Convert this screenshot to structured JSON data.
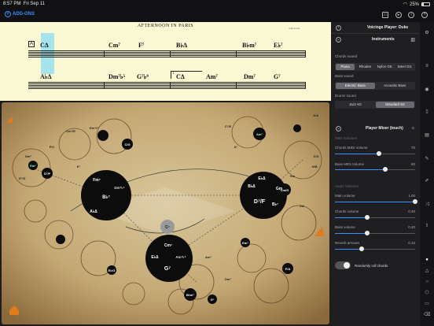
{
  "status": {
    "time": "8:57 PM",
    "date": "Fri Sep 11",
    "battery": "25%"
  },
  "toolbar": {
    "addons_label": "ADD-ONS"
  },
  "sheet": {
    "title": "AFTERNOON IN PARIS",
    "composer": "John Lewis",
    "section_a": "A",
    "ending_1": "1",
    "row1_chords": [
      "CΔ",
      "Cm⁷",
      "F⁷",
      "B♭Δ",
      "B♭m⁷",
      "E♭⁷"
    ],
    "row2_chords": [
      "A♭Δ",
      "Dm⁷♭⁵",
      "G⁷♭⁹",
      "CΔ",
      "Am⁷",
      "Dm⁷",
      "G⁷"
    ]
  },
  "panel": {
    "voicings_title": "Voicings Player: Duke",
    "instruments_title": "Instruments",
    "chords_sound_label": "Chords sound",
    "chords_sound_options": [
      "Piano",
      "Rhodes",
      "Nylon Gtr.",
      "Steel Gtr."
    ],
    "chords_sound_selected": "Piano",
    "bass_sound_label": "Bass sound",
    "bass_sound_options": [
      "Electric Bass",
      "Acoustic Bass"
    ],
    "bass_sound_selected": "Electric Bass",
    "drums_sound_label": "Drums sound",
    "drums_sound_options": [
      "Jazz Kit",
      "Standard Kit"
    ],
    "drums_sound_selected": "Standard Kit",
    "mixer_title": "Player Mixer (touch)",
    "midi_volumes_label": "MIDI Volumes",
    "chords_midi_label": "Chords MIDI Volume",
    "chords_midi_value": "70",
    "chords_midi_fraction": 0.55,
    "bass_midi_label": "Bass MIDI Volume",
    "bass_midi_value": "80",
    "bass_midi_fraction": 0.63,
    "audio_volumes_label": "Audio Volumes",
    "main_volume_label": "Main volume",
    "main_volume_value": "1.00",
    "main_volume_fraction": 1.0,
    "chords_volume_label": "Chords volume",
    "chords_volume_value": "0.40",
    "chords_volume_fraction": 0.4,
    "bass_volume_label": "Bass volume",
    "bass_volume_value": "0.40",
    "bass_volume_fraction": 0.4,
    "reverb_label": "Reverb amount",
    "reverb_value": "0.33",
    "reverb_fraction": 0.33,
    "roll_label": "Randomly roll chords",
    "roll_on": true
  },
  "map": {
    "hub_left": {
      "center": "B♭⁷",
      "top": "Fm⁷",
      "right": "Dm⁷♭⁵",
      "bottom": "A♭Δ"
    },
    "hub_right": {
      "center": "D⁷/F",
      "top": "E♭Δ",
      "right": "Gm",
      "bottom": "B♭⁷",
      "left": "B♭Δ"
    },
    "hub_bottom": {
      "center": "G⁷",
      "top": "Cm⁷",
      "right": "Am⁷♭⁵",
      "left": "E♭Δ"
    },
    "center_node": "C⁷",
    "small_labels": [
      "Em⁷",
      "Cm⁷/E",
      "F/C",
      "Dm⁷",
      "C/G",
      "D⁷/F",
      "G⁷/D",
      "Em⁷♭⁵",
      "E⁷",
      "Am⁷",
      "A⁷",
      "C⁷/E",
      "Gm",
      "G/B",
      "CΔ",
      "Cm/G",
      "D/A",
      "C/G",
      "F/A",
      "Am⁷",
      "G⁷",
      "Em⁷",
      "Dm⁷",
      "B♭m⁷",
      "E♭/G"
    ]
  }
}
